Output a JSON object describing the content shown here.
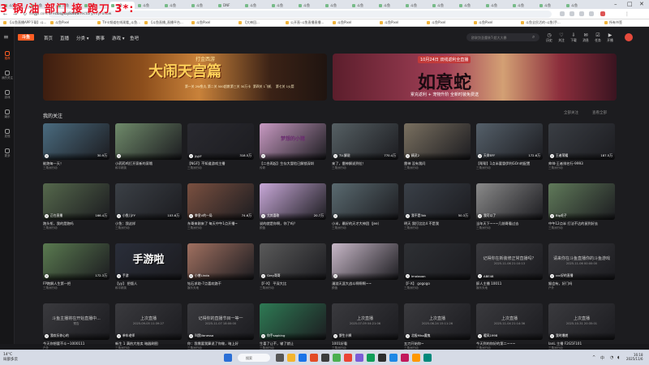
{
  "overlay_text": "3 锅/油 部门 接 跑刀 3*:",
  "overlay_sub": "douyu.com/directory/myFollow",
  "browser": {
    "tabs": [
      "斗鱼",
      "斗鱼",
      "斗鱼",
      "斗鱼",
      "斗鱼",
      "斗鱼",
      "斗鱼",
      "斗鱼",
      "DNF",
      "斗鱼",
      "斗鱼",
      "斗鱼",
      "斗鱼",
      "斗鱼",
      "斗鱼",
      "斗鱼",
      "斗鱼",
      "斗鱼",
      "斗鱼",
      "斗鱼",
      "斗鱼",
      "斗鱼"
    ],
    "url": "douyu.com/directory/myFollow",
    "bookmarks": [
      "【斗鱼直播APP下载】斗...",
      "斗鱼Pixel",
      "TV卡频道在线观看_斗鱼...",
      "【斗鱼直播_直播平台...",
      "斗鱼Pixel",
      "【大神回...",
      "公开直-斗鱼直播直播...",
      "斗鱼Pixel",
      "斗鱼Pixel",
      "斗鱼Pixel",
      "斗鱼Pixel",
      "斗鱼全民活的-斗鱼(手...",
      "所有书签"
    ]
  },
  "sidebar": [
    {
      "label": "推荐",
      "active": true
    },
    {
      "label": "我的关注"
    },
    {
      "label": "游戏"
    },
    {
      "label": "娱乐"
    },
    {
      "label": "发现"
    },
    {
      "label": "更多"
    }
  ],
  "topnav": {
    "logo": "斗鱼",
    "items": [
      "首页",
      "直播",
      "分类 ▾",
      "赛事",
      "游戏 ▾",
      "鱼吧"
    ],
    "search_placeholder": "欧联剑圣魔装T-超大大暴",
    "icons": [
      {
        "icon": "history-icon",
        "label": "历史"
      },
      {
        "icon": "follow-icon",
        "label": "关注"
      },
      {
        "icon": "download-icon",
        "label": "下载"
      },
      {
        "icon": "message-icon",
        "label": "消息"
      },
      {
        "icon": "task-icon",
        "label": "任务"
      },
      {
        "icon": "live-icon",
        "label": "开播"
      }
    ]
  },
  "banner1": {
    "title": "大闹天宫篇",
    "series": "打金西游",
    "items": [
      "第一关 2W鱼丸",
      "第二关 500超燃",
      "第三关 30万卡",
      "第四关 1飞机",
      "第七关 1火箭"
    ],
    "sub": "2W鱼丸    500超燃    30万卡    1飞机    1火箭"
  },
  "banner2": {
    "date": "10月24日",
    "date_sub": "双线返利全直播",
    "title": "如意蛇",
    "sub": "累充返利 + 宠物升阶 全新时装免费送"
  },
  "section": {
    "title": "我的关注",
    "right_items": [
      "全部关注",
      "查看全部"
    ]
  },
  "cards": [
    {
      "name": "",
      "hot": "30.9万",
      "title": "能跑每一天！",
      "cat": "三角洲行动",
      "badge": "",
      "c": "#4a6b7f"
    },
    {
      "name": "",
      "hot": "",
      "title": "小药药鸡打开家新的家哦",
      "cat": "和平精英",
      "badge": "",
      "c": "#6f8a6a"
    },
    {
      "name": "jiyjiF",
      "hot": "318.5万",
      "title": "【NGF】不知道游戏主播",
      "cat": "三角洲行动",
      "badge": "",
      "c": "#2a2a30"
    },
    {
      "name": "",
      "hot": "",
      "title": "【二合再起】生存大冒险已解锁深圳",
      "cat": "传奇",
      "badge": "梦想的小猪",
      "c": "#c89ac2"
    },
    {
      "name": "TV-解说",
      "hot": "770.4万",
      "title": "来了，雷神解说到位！",
      "cat": "三角洲行动",
      "badge": "",
      "c": "#566064"
    },
    {
      "name": "精灵2",
      "hot": "",
      "title": "雷神 没有我问",
      "cat": "三角洲行动",
      "badge": "",
      "c": "#7a7060"
    },
    {
      "name": "天命EFF",
      "hot": "172.6万",
      "title": "【帮帮】1点半要冒伊利GOn的配置",
      "cat": "三角洲行动",
      "badge": "",
      "c": "#55606a"
    },
    {
      "name": "王者荣耀",
      "hot": "187.5万",
      "title": "帅帅·王者排名行-9993",
      "cat": "三角洲行动",
      "badge": "",
      "c": "#3a3e44"
    },
    {
      "name": "正在直播",
      "hot": "166.4万",
      "title": "跑头衔，我的是跑吗",
      "cat": "三角洲行动",
      "badge": "",
      "c": "#55684c"
    },
    {
      "name": "小鱼儿FY",
      "hot": "103.6万",
      "title": "小鱼：我这样",
      "cat": "三角洲行动",
      "badge": "",
      "c": "#3b4046"
    },
    {
      "name": "拳皇V的一局",
      "hot": "74.6万",
      "title": "东哥来刚来了 每天中午1点开播~",
      "cat": "三角洲行动",
      "badge": "",
      "c": "#7a5040"
    },
    {
      "name": "尤其喜歌",
      "hot": "20.7万",
      "title": "说的就是你啊，你了吗？",
      "cat": "颜值",
      "badge": "",
      "c": "#c8a8d8"
    },
    {
      "name": "",
      "hot": "",
      "title": "小米，最好的天才大神团（Jee）",
      "cat": "三角洲行动",
      "badge": "",
      "c": "#5a6a70"
    },
    {
      "name": "我不是3kk",
      "hot": "50.3万",
      "title": "明天 我打比比4 不是我",
      "cat": "三角洲行动",
      "badge": "",
      "c": "#3a4048"
    },
    {
      "name": "我可以了",
      "hot": "",
      "title": "当年天下~~~几前哥看过去",
      "cat": "三角洲行动",
      "badge": "",
      "c": "#8a8a8a"
    },
    {
      "name": "Big毛子",
      "hot": "",
      "title": "中午12点半 打法不达的鼠到好去",
      "cat": "三角洲行动",
      "badge": "",
      "c": "#607a5a"
    },
    {
      "name": "",
      "hot": "172.3万",
      "title": "FP跑解人生第一把",
      "cat": "三角洲行动",
      "badge": "",
      "c": "#5a7a50"
    },
    {
      "name": "手游",
      "hot": "",
      "title": "【yy】 把版人",
      "cat": "和平精英",
      "badge": "",
      "c": "#2a2e3a",
      "big": "手游啦"
    },
    {
      "name": "小曾Linda",
      "hot": "",
      "title": "钻石求助-7点喜欢路干",
      "cat": "娱乐天地",
      "badge": "",
      "c": "#a07060"
    },
    {
      "name": "Grey哥哥",
      "hot": "",
      "title": "【F-X】 平深大比",
      "cat": "三角洲行动",
      "badge": "",
      "c": "#5a5a5a"
    },
    {
      "name": "",
      "hot": "",
      "title": "漫游天涯大战斗啊啊啊~~",
      "cat": "颜值",
      "badge": "",
      "c": "#c8b8c8"
    },
    {
      "name": "imolaoon",
      "hot": "",
      "title": "【F-X】 gogogo",
      "cat": "三角洲行动",
      "badge": "",
      "c": "#2e3034"
    },
    {
      "name": "ABE48",
      "hot": "",
      "title": "醉人主播 10011",
      "cat": "娱乐天地",
      "badge": "",
      "c": "#3a3a3e",
      "cm": "记得你在新装修正常直播吗？",
      "cm2": "2025-11-06 21:10:13"
    },
    {
      "name": "ccc好的直播",
      "hot": "",
      "title": "猴会有，好门吗",
      "cat": "户外",
      "badge": "",
      "c": "#3a3a3e",
      "cm": "请来你在斗鱼直播你的斗鱼游戏",
      "cm2": "2025-11-06 00:00:00"
    },
    {
      "name": "我欢乐你心的",
      "hot": "",
      "title": "今天你想要不斗~1000111",
      "cat": "户外",
      "badge": "",
      "c": "#3a3a3e",
      "cm": "斗鱼主播将在开始直播中...",
      "cm2": "预告"
    },
    {
      "name": "单车老师",
      "hot": "",
      "title": "新生 1 满热大拍卖 暗器刷图",
      "cat": "三角洲行动",
      "badge": "",
      "c": "#3a3a3e",
      "cm": "上次直播",
      "cm2": "2025-09-05 11:39:27"
    },
    {
      "name": "叫我Vanessa",
      "hot": "",
      "title": "你：我需要我算说了你做，暗上好",
      "cat": "三角洲行动",
      "badge": "",
      "c": "#3a3a3e",
      "cm": "记得你的直播节目一等一",
      "cm2": "2025-11-07 18:00:00"
    },
    {
      "name": "你手sapking",
      "hot": "",
      "title": "生喜了让不，输了就让",
      "cat": "三角洲行动",
      "badge": "",
      "c": "#2e7a54"
    },
    {
      "name": "野生小狮",
      "hot": "",
      "title": "1001好看",
      "cat": "三角洲行动",
      "badge": "",
      "c": "#3a3a3e",
      "cm": "上次直播",
      "cm2": "2025-07-09 04:21:06"
    },
    {
      "name": "北极Miss魔鬼",
      "hot": "",
      "title": "五刀开始你~",
      "cat": "三角洲行动",
      "badge": "",
      "c": "#3a3a3e",
      "cm": "上次直播",
      "cm2": "2025-06-24 15:11:26"
    },
    {
      "name": "暖风1998",
      "hot": "",
      "title": "今天到的你好的第二~~~",
      "cat": "三角洲行动",
      "badge": "",
      "c": "#3a3a3e",
      "cm": "上次直播",
      "cm2": "2025-11-04 21:14:36"
    },
    {
      "name": "我时爆燃",
      "hot": "",
      "title": "lanL 主播 F2G5F101",
      "cat": "三角洲行动",
      "badge": "",
      "c": "#3a3a3e",
      "cm": "上次直播",
      "cm2": "2025-10-31 20:35:01"
    }
  ],
  "taskbar": {
    "weather_temp": "14°C",
    "weather_desc": "局部多云",
    "search": "搜索",
    "time": "16:18",
    "date": "2025/11/6",
    "lang": "中"
  }
}
